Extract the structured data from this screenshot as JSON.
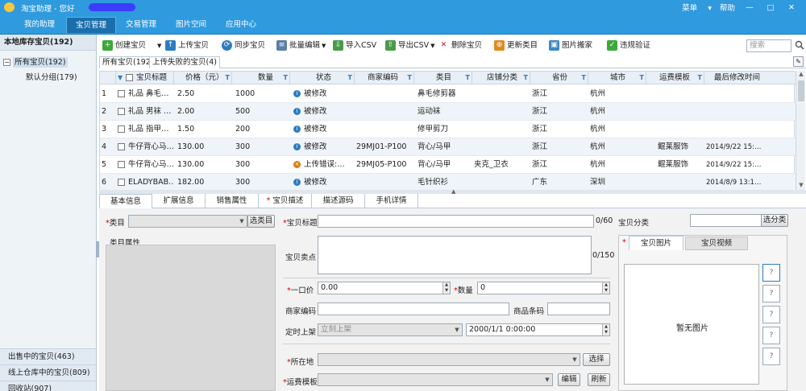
{
  "title_bar": {
    "app_name": "淘宝助理 - 您好",
    "menu": "菜单",
    "help": "帮助",
    "min": "—",
    "max": "□",
    "close": "✕"
  },
  "main_menu": [
    {
      "label": "我的助理",
      "active": false
    },
    {
      "label": "宝贝管理",
      "active": true
    },
    {
      "label": "交易管理",
      "active": false
    },
    {
      "label": "图片空间",
      "active": false
    },
    {
      "label": "应用中心",
      "active": false
    }
  ],
  "sidebar": {
    "header": "本地库存宝贝(192)",
    "tree": {
      "expander": "−",
      "root": "所有宝贝(192)",
      "child": "默认分组(179)"
    },
    "bottom": [
      "出售中的宝贝(463)",
      "线上仓库中的宝贝(809)",
      "回收站(907)"
    ]
  },
  "toolbar": {
    "items": [
      {
        "label": "创建宝贝",
        "icon": "plus-icon",
        "dropdown": true
      },
      {
        "label": "上传宝贝",
        "icon": "upload-icon",
        "dropdown": false
      },
      {
        "label": "同步宝贝",
        "icon": "sync-icon",
        "dropdown": false
      },
      {
        "label": "批量编辑",
        "icon": "batch-edit-icon",
        "dropdown": true
      },
      {
        "label": "导入CSV",
        "icon": "import-icon",
        "dropdown": false
      },
      {
        "label": "导出CSV",
        "icon": "export-icon",
        "dropdown": true
      },
      {
        "label": "删除宝贝",
        "icon": "delete-icon",
        "dropdown": false
      },
      {
        "label": "更新类目",
        "icon": "update-icon",
        "dropdown": false
      },
      {
        "label": "图片搬家",
        "icon": "image-move-icon",
        "dropdown": false
      },
      {
        "label": "违规验证",
        "icon": "check-icon",
        "dropdown": false
      }
    ],
    "search_placeholder": "搜索"
  },
  "sub_tabs": [
    "所有宝贝(192)",
    "上传失败的宝贝(4)"
  ],
  "grid": {
    "columns": [
      "宝贝标题",
      "价格（元）",
      "数量",
      "状态",
      "商家编码",
      "类目",
      "店铺分类",
      "省份",
      "城市",
      "运费模板",
      "最后修改时间"
    ],
    "rows": [
      {
        "num": "1",
        "title": "礼品 鼻毛…",
        "price": "2.50",
        "qty": "1000",
        "status": "被修改",
        "status_type": "info",
        "code": "",
        "category": "鼻毛修剪器",
        "shop_cat": "",
        "province": "浙江",
        "city": "杭州",
        "shipping": "",
        "modified": ""
      },
      {
        "num": "2",
        "title": "礼品 男袜 …",
        "price": "2.00",
        "qty": "500",
        "status": "被修改",
        "status_type": "info",
        "code": "",
        "category": "运动袜",
        "shop_cat": "",
        "province": "浙江",
        "city": "杭州",
        "shipping": "",
        "modified": ""
      },
      {
        "num": "3",
        "title": "礼品 指甲…",
        "price": "1.50",
        "qty": "200",
        "status": "被修改",
        "status_type": "info",
        "code": "",
        "category": "修甲剪刀",
        "shop_cat": "",
        "province": "浙江",
        "city": "杭州",
        "shipping": "",
        "modified": ""
      },
      {
        "num": "4",
        "title": "牛仔背心马…",
        "price": "130.00",
        "qty": "300",
        "status": "被修改",
        "status_type": "info",
        "code": "29MJ01-P100",
        "category": "背心/马甲",
        "shop_cat": "",
        "province": "浙江",
        "city": "杭州",
        "shipping": "鲲莱服饰",
        "modified": "2014/9/22 15:…"
      },
      {
        "num": "5",
        "title": "牛仔背心马…",
        "price": "130.00",
        "qty": "300",
        "status": "上传错误:…",
        "status_type": "error",
        "code": "29MJ05-P100",
        "category": "背心/马甲",
        "shop_cat": "夹克_卫衣",
        "province": "浙江",
        "city": "杭州",
        "shipping": "鲲莱服饰",
        "modified": "2014/9/22 15:…"
      },
      {
        "num": "6",
        "title": "ELADYBAB…",
        "price": "182.00",
        "qty": "300",
        "status": "被修改",
        "status_type": "info",
        "code": "",
        "category": "毛针织衫",
        "shop_cat": "",
        "province": "广东",
        "city": "深圳",
        "shipping": "",
        "modified": "2014/8/9 13:1…"
      }
    ]
  },
  "detail_tabs": [
    "基本信息",
    "扩展信息",
    "销售属性",
    "宝贝描述",
    "描述源码",
    "手机详情"
  ],
  "form": {
    "category_label": "类目",
    "category_btn": "选类目",
    "category_attr": "类目属性",
    "title_label": "宝贝标题",
    "title_counter": "0/60",
    "selling_label": "宝贝卖点",
    "selling_counter": "0/150",
    "price_label": "一口价",
    "price_value": "0.00",
    "qty_label": "数量",
    "qty_value": "0",
    "merchant_code_label": "商家编码",
    "barcode_label": "商品条码",
    "schedule_label": "定时上架",
    "schedule_value": "立刻上架",
    "schedule_time": "2000/1/1 0:00:00",
    "location_label": "所在地",
    "location_btn": "选择",
    "shipping_label": "运费模板",
    "shipping_edit": "编辑",
    "shipping_refresh": "刷新",
    "shop_cat_label": "宝贝分类",
    "shop_cat_btn": "选分类",
    "media_tabs": [
      "宝贝图片",
      "宝贝视频"
    ],
    "no_image": "暂无图片",
    "thumb_placeholder": "?"
  },
  "colors": {
    "brand": "#2f9ade",
    "required": "#d00000",
    "info": "#2c7cc1",
    "error": "#e07b00"
  }
}
